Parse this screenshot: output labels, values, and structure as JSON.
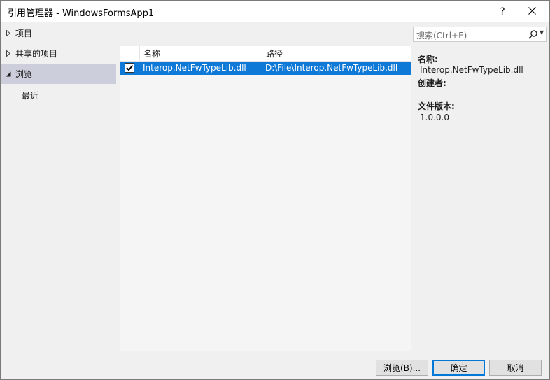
{
  "window": {
    "title": "引用管理器 - WindowsFormsApp1",
    "help_label": "?",
    "close_label": "✕"
  },
  "nav": {
    "items": [
      {
        "label": "项目",
        "arrow": "▶",
        "selected": false
      },
      {
        "label": "共享的项目",
        "arrow": "▶",
        "selected": false
      },
      {
        "label": "浏览",
        "arrow": "◢",
        "selected": true
      }
    ],
    "sub_items": [
      {
        "label": "最近"
      }
    ]
  },
  "list": {
    "columns": [
      "名称",
      "路径"
    ],
    "rows": [
      {
        "checked": true,
        "name": "Interop.NetFwTypeLib.dll",
        "path": "D:\\File\\Interop.NetFwTypeLib.dll"
      }
    ]
  },
  "search": {
    "placeholder": "搜索(Ctrl+E)",
    "icon": "search-icon"
  },
  "details": {
    "name_label": "名称:",
    "name_value": "Interop.NetFwTypeLib.dll",
    "creator_label": "创建者:",
    "version_label": "文件版本:",
    "version_value": "1.0.0.0"
  },
  "buttons": {
    "browse": "浏览(B)...",
    "ok": "确定",
    "cancel": "取消"
  },
  "colors": {
    "selection": "#0f79d7",
    "nav_selected": "#cccedb",
    "default_button_border": "#0078d7"
  }
}
